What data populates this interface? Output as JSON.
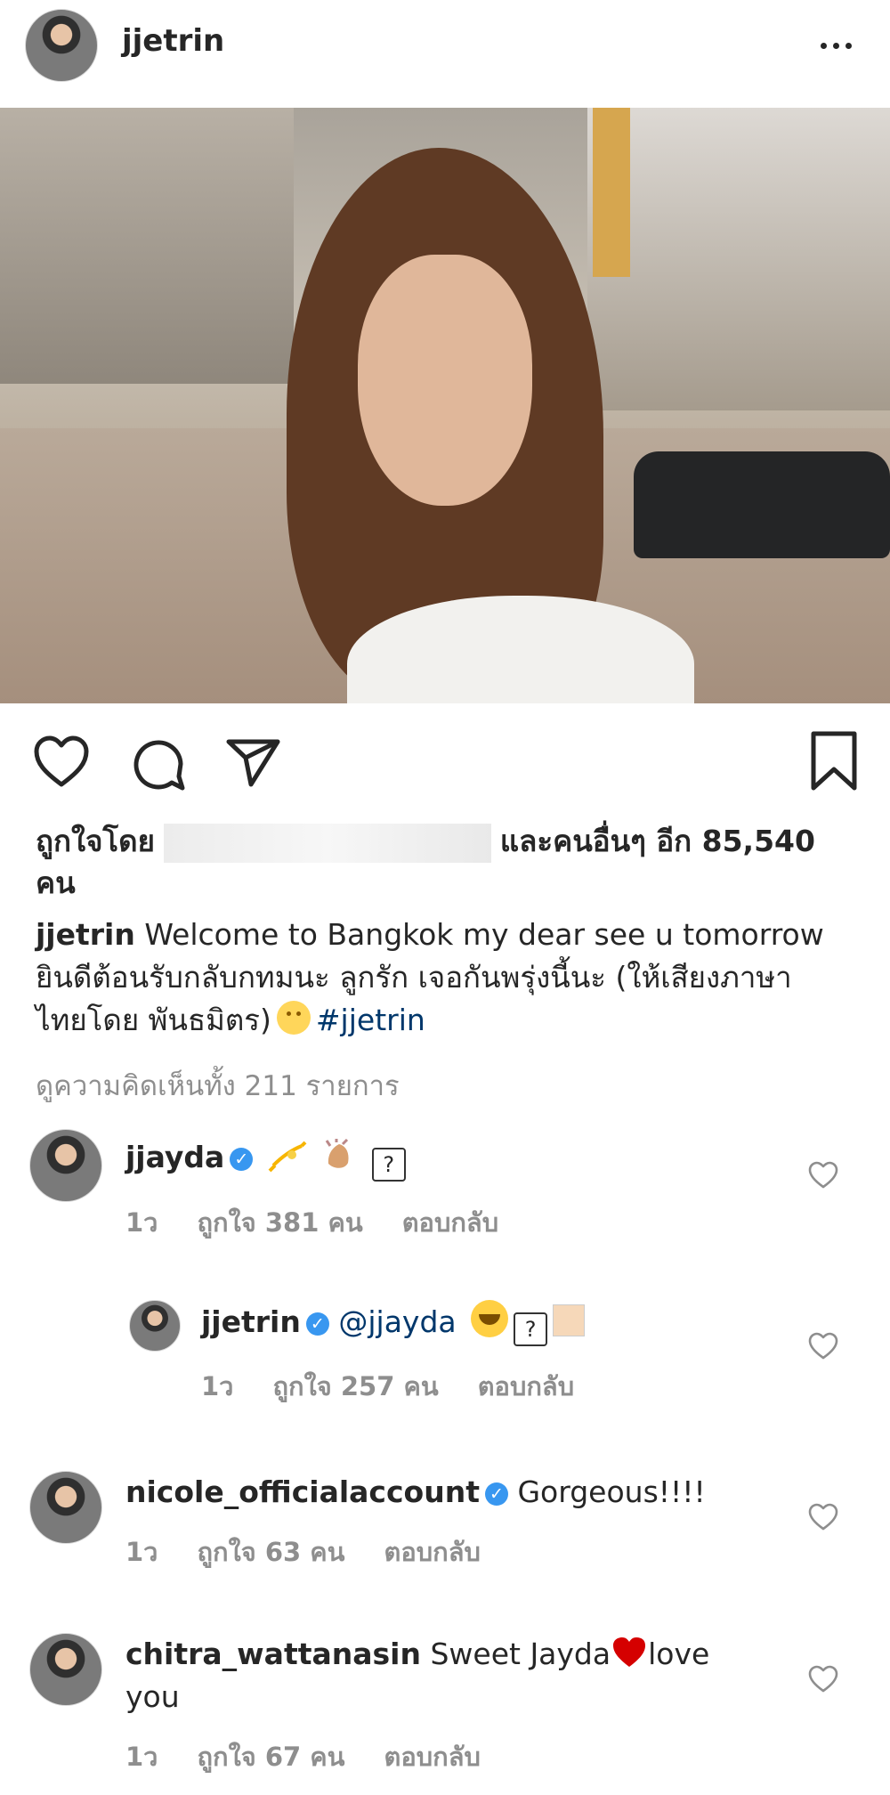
{
  "header": {
    "username": "jjetrin"
  },
  "post": {
    "likes": {
      "prefix": "ถูกใจโดย",
      "suffix": "และคนอื่นๆ อีก 85,540",
      "unit": "คน"
    },
    "caption": {
      "username": "jjetrin",
      "line1": "Welcome to Bangkok my dear  see u tomorrow",
      "line2": "ยินดีต้อนรับกลับกทมนะ ลูกรัก เจอกันพรุ่งนี้นะ (ให้เสียงภาษา",
      "line3": "ไทยโดย พันธมิตร)",
      "hashtag": "#jjetrin"
    },
    "view_all_comments": "ดูความคิดเห็นทั้ง 211 รายการ"
  },
  "comments": [
    {
      "username": "jjayda",
      "time": "1ว",
      "likes": "ถูกใจ 381 คน",
      "reply": "ตอบกลับ"
    },
    {
      "username": "jjetrin",
      "mention": "@jjayda",
      "time": "1ว",
      "likes": "ถูกใจ 257 คน",
      "reply": "ตอบกลับ"
    },
    {
      "username": "nicole_officialaccount",
      "text": "Gorgeous!!!!",
      "time": "1ว",
      "likes": "ถูกใจ 63 คน",
      "reply": "ตอบกลับ"
    },
    {
      "username": "chitra_wattanasin",
      "text": "Sweet Jayda",
      "text2": "love",
      "text3": "you",
      "time": "1ว",
      "likes": "ถูกใจ 67 คน",
      "reply": "ตอบกลับ"
    }
  ],
  "colors": {
    "link": "#00376b",
    "muted": "#8e8e8e",
    "verified": "#3897f0",
    "heart": "#d50000"
  }
}
